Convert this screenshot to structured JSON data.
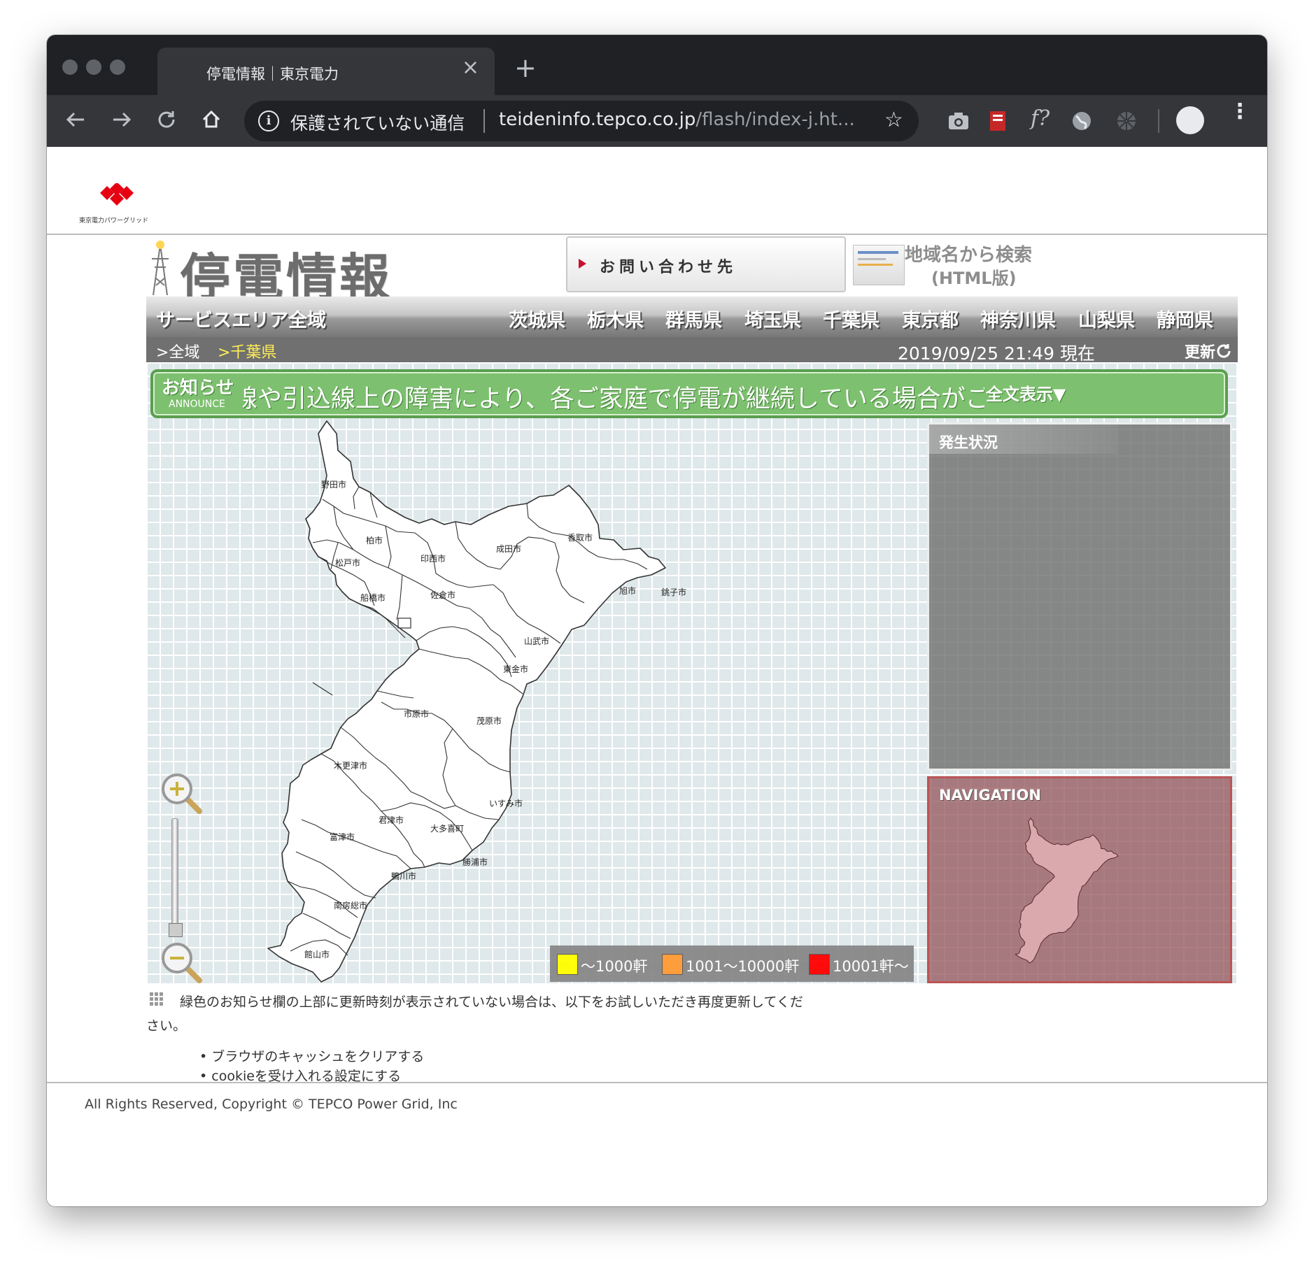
{
  "browser": {
    "tab_title": "停電情報｜東京電力",
    "tab_close": "×",
    "new_tab": "+",
    "security_label": "保護されていない通信",
    "url_host": "teideninfo.tepco.co.jp",
    "url_path": "/flash/index-j.ht...",
    "icons": [
      "back-icon",
      "forward-icon",
      "reload-icon",
      "home-icon",
      "info-icon",
      "star-icon",
      "camera-icon",
      "pdf-icon",
      "font-icon",
      "globe-icon",
      "aperture-icon",
      "profile-icon",
      "menu-icon"
    ],
    "ext_font_label": "f?"
  },
  "header": {
    "logo_caption": "東京電力パワーグリッド",
    "title": "停電情報",
    "contact_label": "お問い合わせ先",
    "search_label_line1": "地域名から検索",
    "search_label_line2": "(HTML版)"
  },
  "nav": {
    "area": "サービスエリア全域",
    "prefectures": [
      "茨城県",
      "栃木県",
      "群馬県",
      "埼玉県",
      "千葉県",
      "東京都",
      "神奈川県",
      "山梨県",
      "静岡県"
    ]
  },
  "breadcrumb": {
    "all": ">全域",
    "current": ">千葉県",
    "timestamp": "2019/09/25 21:49 現在",
    "refresh": "更新"
  },
  "announce": {
    "title": "お知らせ",
    "subtitle": "ANNOUNCE",
    "text": "線や引込線上の障害により、各ご家庭で停電が継続している場合がございます。調査",
    "more": "全文表示▼"
  },
  "map": {
    "cities": [
      "野田市",
      "柏市",
      "松戸市",
      "印西市",
      "成田市",
      "香取市",
      "旭市",
      "銚子市",
      "船橋市",
      "佐倉市",
      "山武市",
      "東金市",
      "市原市",
      "茂原市",
      "木更津市",
      "君津市",
      "いすみ市",
      "大多喜町",
      "富津市",
      "鴨川市",
      "勝浦市",
      "南房総市",
      "館山市"
    ]
  },
  "legend": {
    "items": [
      {
        "label": "～1000軒",
        "color": "#ffff00"
      },
      {
        "label": "1001～10000軒",
        "color": "#ff9933"
      },
      {
        "label": "10001軒～",
        "color": "#ff0000"
      }
    ]
  },
  "status_panel": {
    "title": "発生状況"
  },
  "nav_panel": {
    "title": "NAVIGATION"
  },
  "notes": {
    "line1": "緑色のお知らせ欄の上部に更新時刻が表示されていない場合は、以下をお試しいただき再度更新してくだ",
    "line2": "さい。",
    "bullets": [
      "ブラウザのキャッシュをクリアする",
      "cookieを受け入れる設定にする"
    ]
  },
  "footer": {
    "copyright": "All Rights Reserved, Copyright © TEPCO Power Grid, Inc"
  },
  "colors": {
    "accent_red": "#c8102e",
    "announce_green": "#7dc06f",
    "nav_gray": "#707070"
  }
}
